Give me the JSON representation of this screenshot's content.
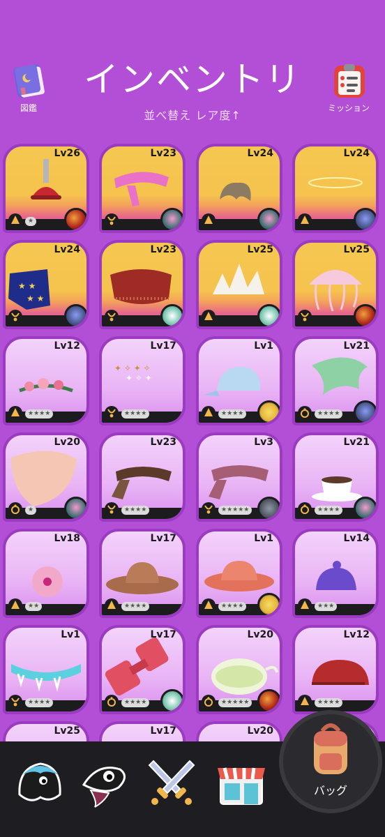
{
  "header": {
    "title": "インベントリ",
    "sort_label": "並べ替え レア度↑",
    "book_label": "図鑑",
    "mission_label": "ミッション"
  },
  "items": [
    {
      "level": "Lv26",
      "rarity": "rare",
      "type": "hat",
      "item": "plunger",
      "char": "lava",
      "stars": "★"
    },
    {
      "level": "Lv23",
      "rarity": "rare",
      "type": "neck",
      "item": "pink-scarf",
      "char": "pink",
      "stars": ""
    },
    {
      "level": "Lv24",
      "rarity": "rare",
      "type": "hat",
      "item": "hair-tuft",
      "char": "pink",
      "stars": ""
    },
    {
      "level": "Lv24",
      "rarity": "rare",
      "type": "hat",
      "item": "halo",
      "char": "blue",
      "stars": ""
    },
    {
      "level": "Lv24",
      "rarity": "rare",
      "type": "neck",
      "item": "star-cape",
      "char": "blue",
      "stars": ""
    },
    {
      "level": "Lv23",
      "rarity": "rare",
      "type": "neck",
      "item": "red-shawl",
      "char": "wind",
      "stars": ""
    },
    {
      "level": "Lv25",
      "rarity": "rare",
      "type": "hat",
      "item": "spiky-crown",
      "char": "wind",
      "stars": ""
    },
    {
      "level": "Lv25",
      "rarity": "rare",
      "type": "neck",
      "item": "jellyfish",
      "char": "lava",
      "stars": ""
    },
    {
      "level": "Lv12",
      "rarity": "common",
      "type": "hat",
      "item": "flower-crown",
      "char": "none",
      "stars": "★★★★"
    },
    {
      "level": "Lv17",
      "rarity": "common",
      "type": "neck",
      "item": "butterflies",
      "char": "none",
      "stars": "★★★★"
    },
    {
      "level": "Lv1",
      "rarity": "common",
      "type": "hat",
      "item": "baseball-cap",
      "char": "gold",
      "stars": "★★★★"
    },
    {
      "level": "Lv21",
      "rarity": "common",
      "type": "ring",
      "item": "jade-stone",
      "char": "blue",
      "stars": "★★★★"
    },
    {
      "level": "Lv20",
      "rarity": "common",
      "type": "ring",
      "item": "shell",
      "char": "pink",
      "stars": "★"
    },
    {
      "level": "Lv23",
      "rarity": "common",
      "type": "neck",
      "item": "striped-scarf",
      "char": "none",
      "stars": "★★★★"
    },
    {
      "level": "Lv3",
      "rarity": "common",
      "type": "neck",
      "item": "mauve-scarf",
      "char": "grey",
      "stars": "★★★★★"
    },
    {
      "level": "Lv21",
      "rarity": "common",
      "type": "ring",
      "item": "coffee-cup",
      "char": "pink",
      "stars": "★★★★"
    },
    {
      "level": "Lv18",
      "rarity": "common",
      "type": "hat",
      "item": "hibiscus",
      "char": "none",
      "stars": "★★"
    },
    {
      "level": "Lv17",
      "rarity": "common",
      "type": "hat",
      "item": "cowboy-hat",
      "char": "none",
      "stars": "★★★★"
    },
    {
      "level": "Lv1",
      "rarity": "common",
      "type": "hat",
      "item": "sun-hat",
      "char": "gold",
      "stars": "★★★★"
    },
    {
      "level": "Lv14",
      "rarity": "common",
      "type": "hat",
      "item": "purple-cap",
      "char": "none",
      "stars": "★★★"
    },
    {
      "level": "Lv1",
      "rarity": "common",
      "type": "neck",
      "item": "spike-collar",
      "char": "none",
      "stars": "★★★★"
    },
    {
      "level": "Lv17",
      "rarity": "common",
      "type": "ring",
      "item": "dumbbell",
      "char": "wind",
      "stars": "★★★★"
    },
    {
      "level": "Lv20",
      "rarity": "common",
      "type": "ring",
      "item": "teapot",
      "char": "lava",
      "stars": "★★★★★"
    },
    {
      "level": "Lv12",
      "rarity": "common",
      "type": "hat",
      "item": "red-cap",
      "char": "none",
      "stars": "★★★★"
    },
    {
      "level": "Lv25",
      "rarity": "common",
      "type": "hat",
      "item": "unknown",
      "char": "none",
      "stars": ""
    },
    {
      "level": "Lv17",
      "rarity": "common",
      "type": "hat",
      "item": "unknown",
      "char": "none",
      "stars": ""
    },
    {
      "level": "Lv20",
      "rarity": "common",
      "type": "hat",
      "item": "unknown",
      "char": "none",
      "stars": ""
    },
    {
      "level": "",
      "rarity": "common",
      "type": "hat",
      "item": "unknown",
      "char": "none",
      "stars": ""
    }
  ],
  "colors": {
    "background": "#b24fd6",
    "card_border": "#9b3bc1",
    "bar": "#1e1d21",
    "accent": "#f2b74a"
  },
  "nav": {
    "bag_label": "バッグ",
    "items": [
      {
        "icon": "blob-character-icon"
      },
      {
        "icon": "bird-character-icon"
      },
      {
        "icon": "crossed-swords-icon"
      },
      {
        "icon": "shop-icon"
      }
    ]
  }
}
